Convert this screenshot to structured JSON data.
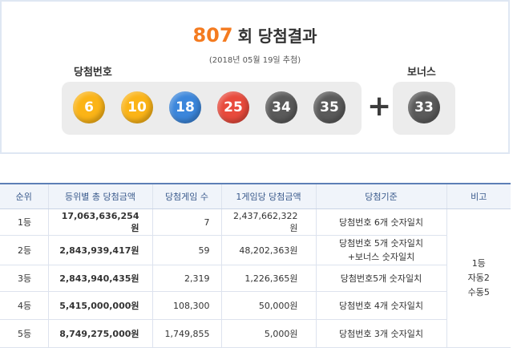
{
  "header": {
    "round_number": "807",
    "title_suffix": "회 당첨결과",
    "draw_date": "(2018년 05월 19일 추첨)",
    "winning_label": "당첨번호",
    "bonus_label": "보너스",
    "plus_symbol": "+"
  },
  "winning_numbers": [
    {
      "value": "6",
      "color": "#fbb417"
    },
    {
      "value": "10",
      "color": "#fbb417"
    },
    {
      "value": "18",
      "color": "#3b86db"
    },
    {
      "value": "25",
      "color": "#e84a3c"
    },
    {
      "value": "34",
      "color": "#5a5a5a"
    },
    {
      "value": "35",
      "color": "#5a5a5a"
    }
  ],
  "bonus_number": {
    "value": "33",
    "color": "#5a5a5a"
  },
  "table": {
    "headers": [
      "순위",
      "등위별 총 당첨금액",
      "당첨게임 수",
      "1게임당 당첨금액",
      "당첨기준",
      "비고"
    ],
    "rows": [
      {
        "rank": "1등",
        "total": "17,063,636,254원",
        "count": "7",
        "per_game": "2,437,662,322원",
        "criteria_line1": "당첨번호 6개 숫자일치",
        "criteria_line2": ""
      },
      {
        "rank": "2등",
        "total": "2,843,939,417원",
        "count": "59",
        "per_game": "48,202,363원",
        "criteria_line1": "당첨번호 5개 숫자일치",
        "criteria_line2": "+보너스 숫자일치"
      },
      {
        "rank": "3등",
        "total": "2,843,940,435원",
        "count": "2,319",
        "per_game": "1,226,365원",
        "criteria_line1": "당첨번호5개 숫자일치",
        "criteria_line2": ""
      },
      {
        "rank": "4등",
        "total": "5,415,000,000원",
        "count": "108,300",
        "per_game": "50,000원",
        "criteria_line1": "당첨번호 4개 숫자일치",
        "criteria_line2": ""
      },
      {
        "rank": "5등",
        "total": "8,749,275,000원",
        "count": "1,749,855",
        "per_game": "5,000원",
        "criteria_line1": "당첨번호 3개 숫자일치",
        "criteria_line2": ""
      }
    ],
    "note_lines": [
      "1등",
      "자동2",
      "수동5"
    ]
  },
  "colors": {
    "accent_orange": "#f47b20",
    "header_blue": "#3a5a8c",
    "panel_border": "#dfe7f3"
  }
}
